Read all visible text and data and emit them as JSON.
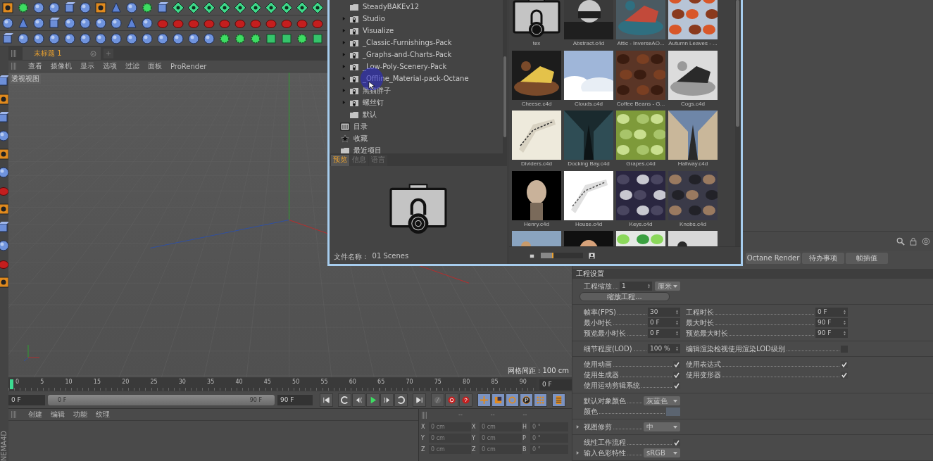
{
  "document_tab": {
    "label": "未标题 1",
    "selected": true
  },
  "viewport": {
    "menu": [
      "查看",
      "摄像机",
      "显示",
      "选项",
      "过滤",
      "面板",
      "ProRender"
    ],
    "label": "透视视图",
    "grid_spacing": "网格间距 : 100 cm"
  },
  "timeline": {
    "ticks": [
      "0",
      "5",
      "10",
      "15",
      "20",
      "25",
      "30",
      "35",
      "40",
      "45",
      "50",
      "55",
      "60",
      "65",
      "70",
      "75",
      "80",
      "85",
      "90"
    ],
    "current_frame": "0 F"
  },
  "transport": {
    "start": "0 F",
    "range_start": "0 F",
    "range_end": "90 F",
    "end": "90 F",
    "range": {
      "level": 1
    }
  },
  "material_manager": {
    "menu": [
      "创建",
      "编辑",
      "功能",
      "纹理"
    ]
  },
  "coordinates": {
    "disabled": true,
    "headers": [
      "--",
      "--",
      "--"
    ],
    "rows": [
      {
        "cells": [
          {
            "axis": "X",
            "value": "0 cm"
          },
          {
            "axis": "X",
            "value": "0 cm"
          },
          {
            "axis": "H",
            "value": "0 °"
          }
        ]
      },
      {
        "cells": [
          {
            "axis": "Y",
            "value": "0 cm"
          },
          {
            "axis": "Y",
            "value": "0 cm"
          },
          {
            "axis": "P",
            "value": "0 °"
          }
        ]
      },
      {
        "cells": [
          {
            "axis": "Z",
            "value": "0 cm"
          },
          {
            "axis": "Z",
            "value": "0 cm"
          },
          {
            "axis": "B",
            "value": "0 °"
          }
        ]
      }
    ]
  },
  "logo": "NEMA4D",
  "content_browser": {
    "tree": [
      {
        "children": [
          {
            "label": "SteadyBAKEv12",
            "kind": "folder"
          },
          {
            "label": "Studio",
            "kind": "locked",
            "expanded": false
          },
          {
            "label": "Visualize",
            "kind": "locked",
            "expanded": false
          },
          {
            "label": "_Classic-Furnishings-Pack",
            "kind": "locked",
            "expanded": false
          },
          {
            "label": "_Graphs-and-Charts-Pack",
            "kind": "locked",
            "expanded": false
          },
          {
            "label": "_Low-Poly-Scenery-Pack",
            "kind": "locked",
            "expanded": false
          },
          {
            "label": "_Offline_Material-pack-Octane",
            "kind": "locked",
            "expanded": false
          },
          {
            "label": "黑猫胖子",
            "kind": "locked",
            "expanded": false
          },
          {
            "label": "螺丝钉",
            "kind": "locked",
            "expanded": false
          },
          {
            "label": "默认",
            "kind": "folder"
          }
        ]
      },
      {
        "label": "目录",
        "kind": "catalog"
      },
      {
        "label": "收藏",
        "kind": "star"
      },
      {
        "label": "最近项目",
        "kind": "folder"
      }
    ],
    "tabs": [
      {
        "label": "预览",
        "selected": true
      },
      {
        "label": "信息",
        "selected": false
      },
      {
        "label": "语言",
        "selected": false
      }
    ],
    "file_name_label": "文件名称 :",
    "file_name": "01 Scenes",
    "tiles": [
      {
        "label": "tex",
        "kind": "folder"
      },
      {
        "label": "Abstract.c4d",
        "kind": "picture"
      },
      {
        "label": "Attic - InverseAO...",
        "kind": "picture"
      },
      {
        "label": "Autumn Leaves - ...",
        "kind": "picture"
      },
      {
        "label": "Cheese.c4d",
        "kind": "picture"
      },
      {
        "label": "Clouds.c4d",
        "kind": "picture"
      },
      {
        "label": "Coffee Beans - G...",
        "kind": "picture"
      },
      {
        "label": "Cogs.c4d",
        "kind": "picture"
      },
      {
        "label": "Dividers.c4d",
        "kind": "picture"
      },
      {
        "label": "Docking Bay.c4d",
        "kind": "picture"
      },
      {
        "label": "Grapes.c4d",
        "kind": "picture"
      },
      {
        "label": "Hallway.c4d",
        "kind": "picture"
      },
      {
        "label": "Henry.c4d",
        "kind": "picture"
      },
      {
        "label": "House.c4d",
        "kind": "picture"
      },
      {
        "label": "Keys.c4d",
        "kind": "picture"
      },
      {
        "label": "Knobs.c4d",
        "kind": "picture"
      },
      {
        "kind": "picture"
      },
      {
        "kind": "picture"
      },
      {
        "kind": "picture"
      },
      {
        "kind": "picture"
      }
    ],
    "thumb_size": {
      "level": 0.3
    }
  },
  "attributes": {
    "tabs": [
      {
        "label": "Octane Render",
        "selected": false
      },
      {
        "label": "待办事项",
        "selected": false
      },
      {
        "label": "帧插值",
        "selected": false
      }
    ],
    "section": "工程设置",
    "groups": [
      {
        "rows": [
          {
            "cells": [
              {
                "kind": "number",
                "label": "工程缩放",
                "value": "1",
                "unit": "厘米"
              }
            ]
          },
          {
            "cells": [
              {
                "kind": "button",
                "label": "缩放工程..."
              }
            ]
          }
        ]
      },
      {
        "rows": [
          {
            "cells": [
              {
                "kind": "number",
                "label": "帧率(FPS)",
                "value": "30"
              },
              {
                "kind": "number",
                "label": "工程时长",
                "value": "0 F"
              }
            ]
          },
          {
            "cells": [
              {
                "kind": "number",
                "label": "最小时长",
                "value": "0 F"
              },
              {
                "kind": "number",
                "label": "最大时长",
                "value": "90 F"
              }
            ]
          },
          {
            "cells": [
              {
                "kind": "number",
                "label": "预览最小时长",
                "value": "0 F"
              },
              {
                "kind": "number",
                "label": "预览最大时长",
                "value": "90 F"
              }
            ]
          }
        ]
      },
      {
        "rows": [
          {
            "cells": [
              {
                "kind": "number",
                "label": "细节程度(LOD)",
                "value": "100 %"
              },
              {
                "kind": "check",
                "label": "编辑渲染检视使用渲染LOD级别",
                "checked": false
              }
            ]
          }
        ]
      },
      {
        "rows": [
          {
            "cells": [
              {
                "kind": "check",
                "label": "使用动画",
                "checked": true
              },
              {
                "kind": "check",
                "label": "使用表达式",
                "checked": true
              }
            ]
          },
          {
            "cells": [
              {
                "kind": "check",
                "label": "使用生成器",
                "checked": true
              },
              {
                "kind": "check",
                "label": "使用变形器",
                "checked": true
              }
            ]
          },
          {
            "cells": [
              {
                "kind": "check",
                "label": "使用运动剪辑系统",
                "checked": true
              }
            ]
          }
        ]
      },
      {
        "rows": [
          {
            "cells": [
              {
                "kind": "dropdown",
                "label": "默认对象颜色",
                "value": "灰蓝色"
              }
            ]
          },
          {
            "cells": [
              {
                "kind": "swatch",
                "label": "颜色",
                "color": "#5b6470"
              }
            ]
          }
        ]
      },
      {
        "rows": [
          {
            "expanded": false,
            "cells": [
              {
                "kind": "dropdown",
                "label": "视图修剪",
                "value": "中"
              }
            ]
          }
        ]
      },
      {
        "rows": [
          {
            "cells": [
              {
                "kind": "check",
                "label": "线性工作流程",
                "checked": true
              }
            ]
          },
          {
            "expanded": false,
            "cells": [
              {
                "kind": "dropdown",
                "label": "输入色彩特性",
                "value": "sRGB"
              }
            ]
          }
        ]
      }
    ]
  }
}
